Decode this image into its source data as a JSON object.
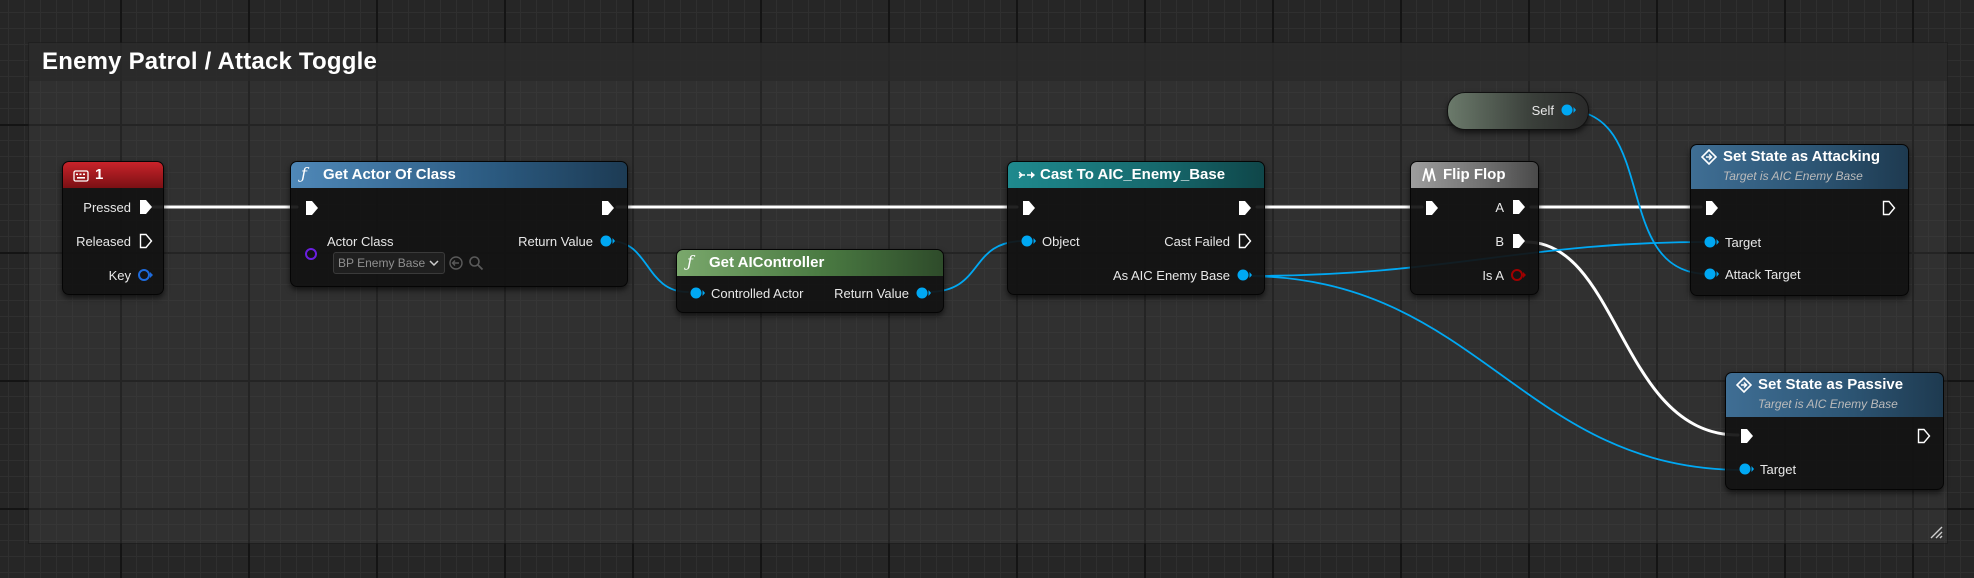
{
  "comment": {
    "title": "Enemy Patrol / Attack Toggle"
  },
  "nodes": {
    "key_event": {
      "title": "1",
      "pins": {
        "pressed": "Pressed",
        "released": "Released",
        "key": "Key"
      }
    },
    "get_actor_of_class": {
      "title": "Get Actor Of Class",
      "pins": {
        "actor_class": "Actor Class",
        "return_value": "Return Value"
      },
      "actor_class_value": "BP Enemy Base"
    },
    "get_ai_controller": {
      "title": "Get AIController",
      "pins": {
        "controlled_actor": "Controlled Actor",
        "return_value": "Return Value"
      }
    },
    "cast_to": {
      "title": "Cast To AIC_Enemy_Base",
      "pins": {
        "object": "Object",
        "cast_failed": "Cast Failed",
        "as_enemy_base": "As AIC Enemy Base"
      }
    },
    "flip_flop": {
      "title": "Flip Flop",
      "pins": {
        "a": "A",
        "b": "B",
        "is_a": "Is A"
      }
    },
    "self": {
      "label": "Self"
    },
    "set_attacking": {
      "title": "Set State as Attacking",
      "subtitle": "Target is AIC Enemy Base",
      "pins": {
        "target": "Target",
        "attack_target": "Attack Target"
      }
    },
    "set_passive": {
      "title": "Set State as Passive",
      "subtitle": "Target is AIC Enemy Base",
      "pins": {
        "target": "Target"
      }
    }
  },
  "colors": {
    "exec_wire": "#ffffff",
    "object_pin": "#00a8f3",
    "class_pin": "#6a1fe0",
    "bool_pin": "#9a0000",
    "struct_pin": "#0057c8",
    "event_header": "#b0161c",
    "pure_function_header": "#4d7d45",
    "function_header": "#3c6e93",
    "cast_header": "#1a6d72",
    "macro_header": "#8e8e8e"
  }
}
